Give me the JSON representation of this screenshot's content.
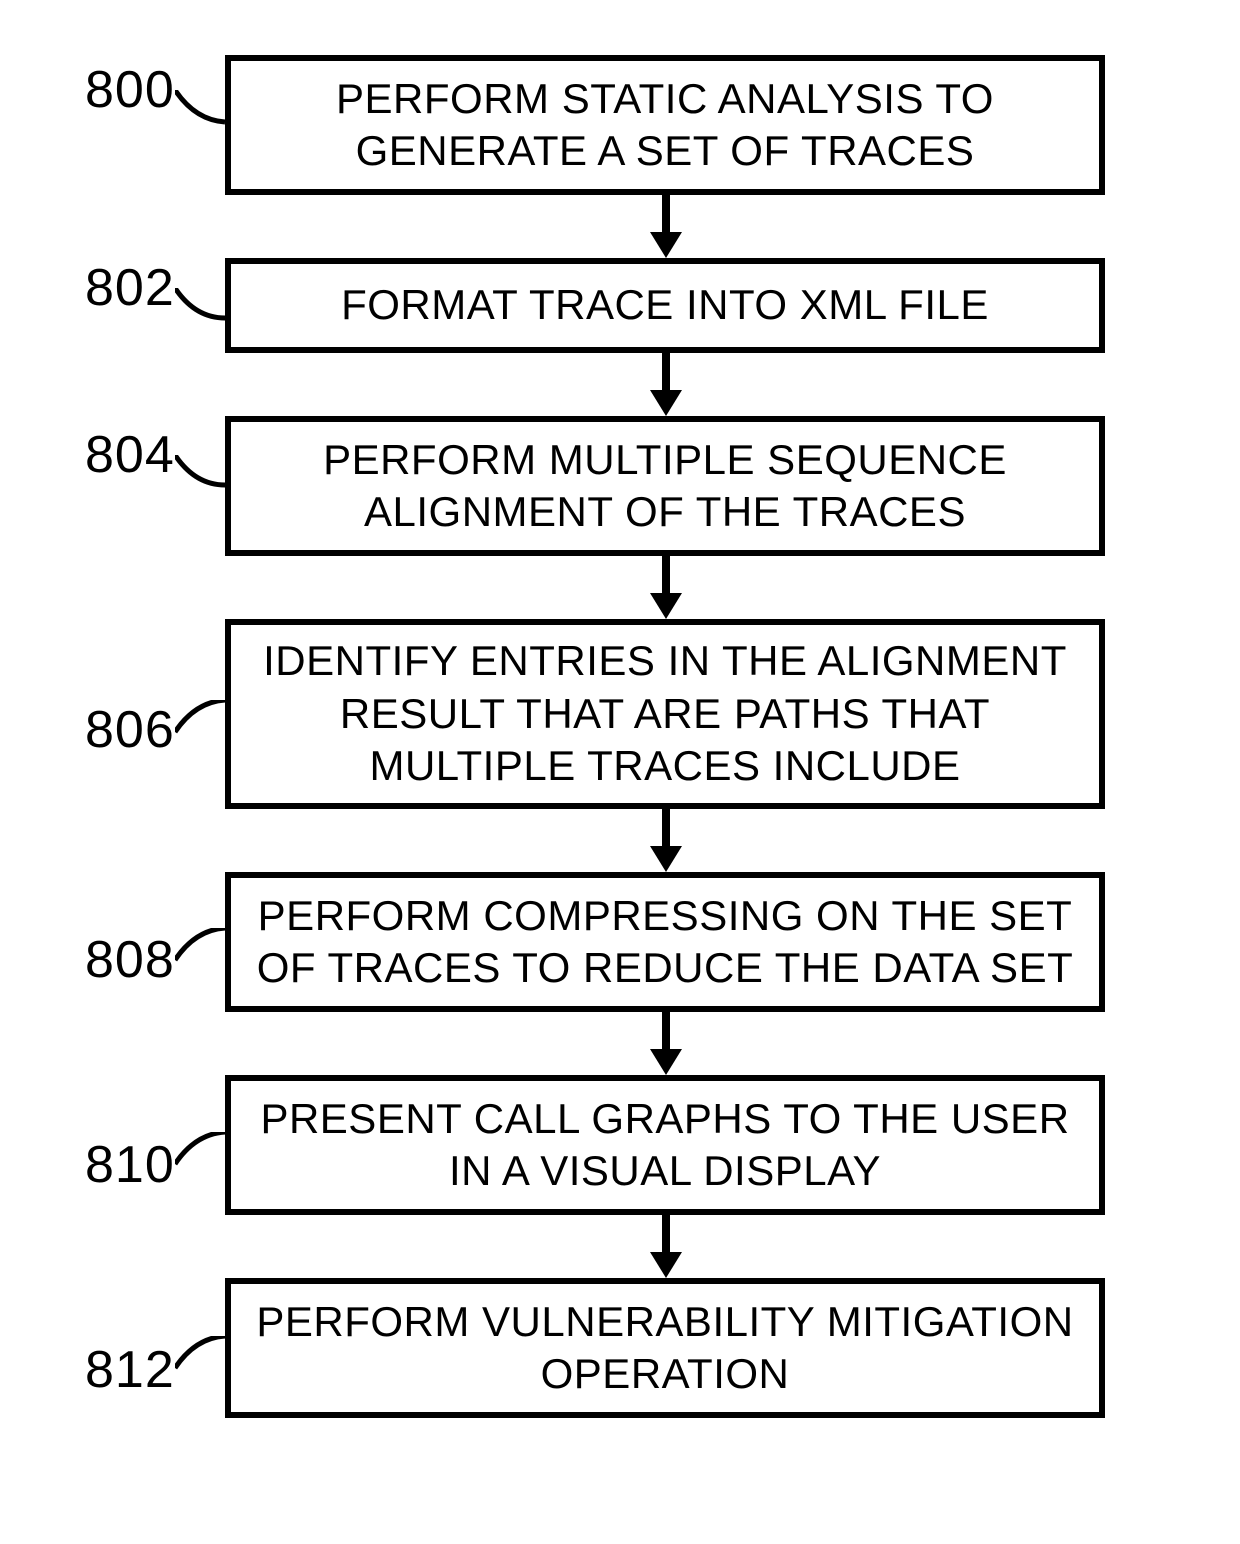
{
  "chart_data": {
    "type": "flowchart",
    "direction": "top-to-bottom",
    "steps": [
      {
        "id": "800",
        "text": "PERFORM STATIC ANALYSIS TO GENERATE A SET OF TRACES"
      },
      {
        "id": "802",
        "text": "FORMAT TRACE INTO XML FILE"
      },
      {
        "id": "804",
        "text": "PERFORM MULTIPLE SEQUENCE ALIGNMENT OF THE TRACES"
      },
      {
        "id": "806",
        "text": "IDENTIFY ENTRIES IN THE ALIGNMENT RESULT THAT ARE PATHS THAT MULTIPLE TRACES INCLUDE"
      },
      {
        "id": "808",
        "text": "PERFORM COMPRESSING ON THE SET OF TRACES TO REDUCE THE DATA SET"
      },
      {
        "id": "810",
        "text": "PRESENT CALL GRAPHS TO THE USER IN A VISUAL DISPLAY"
      },
      {
        "id": "812",
        "text": "PERFORM VULNERABILITY MITIGATION OPERATION"
      }
    ],
    "edges": [
      [
        "800",
        "802"
      ],
      [
        "802",
        "804"
      ],
      [
        "804",
        "806"
      ],
      [
        "806",
        "808"
      ],
      [
        "808",
        "810"
      ],
      [
        "810",
        "812"
      ]
    ]
  }
}
